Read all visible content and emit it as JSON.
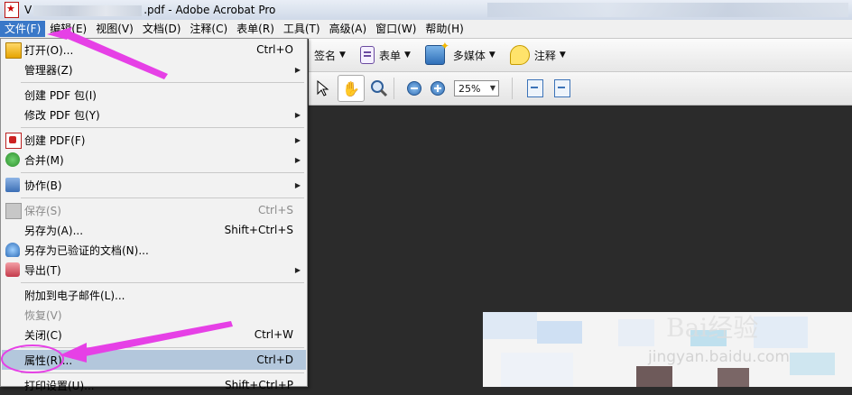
{
  "window": {
    "title_prefix": "V",
    "title_suffix": ".pdf - Adobe Acrobat Pro"
  },
  "menubar": [
    {
      "name": "menu-file",
      "label": "文件(F)",
      "active": true
    },
    {
      "name": "menu-edit",
      "label": "编辑(E)"
    },
    {
      "name": "menu-view",
      "label": "视图(V)"
    },
    {
      "name": "menu-document",
      "label": "文档(D)"
    },
    {
      "name": "menu-comments",
      "label": "注释(C)"
    },
    {
      "name": "menu-forms",
      "label": "表单(R)"
    },
    {
      "name": "menu-tools",
      "label": "工具(T)"
    },
    {
      "name": "menu-advanced",
      "label": "高级(A)"
    },
    {
      "name": "menu-window",
      "label": "窗口(W)"
    },
    {
      "name": "menu-help",
      "label": "帮助(H)"
    }
  ],
  "toolbar1": {
    "sign_label": "签名",
    "forms_label": "表单",
    "multimedia_label": "多媒体",
    "comment_label": "注释"
  },
  "toolbar2": {
    "zoom_value": "25%"
  },
  "file_menu": {
    "items": [
      {
        "label": "打开(O)...",
        "shortcut": "Ctrl+O"
      },
      {
        "label": "管理器(Z)"
      },
      {
        "label": "创建 PDF 包(I)"
      },
      {
        "label": "修改 PDF 包(Y)"
      },
      {
        "label": "创建 PDF(F)"
      },
      {
        "label": "合并(M)"
      },
      {
        "label": "协作(B)"
      },
      {
        "label": "保存(S)",
        "shortcut": "Ctrl+S"
      },
      {
        "label": "另存为(A)...",
        "shortcut": "Shift+Ctrl+S"
      },
      {
        "label": "另存为已验证的文档(N)..."
      },
      {
        "label": "导出(T)"
      },
      {
        "label": "附加到电子邮件(L)..."
      },
      {
        "label": "恢复(V)"
      },
      {
        "label": "关闭(C)",
        "shortcut": "Ctrl+W"
      },
      {
        "label": "属性(R)...",
        "shortcut": "Ctrl+D"
      },
      {
        "label": "打印设置(U)...",
        "shortcut": "Shift+Ctrl+P"
      }
    ]
  },
  "watermark": {
    "brand": "Bai经验",
    "url": "jingyan.baidu.com"
  },
  "colors": {
    "menu_active": "#3a78c8",
    "selected_item": "#b3c7dc",
    "annotation_arrow": "#e640e6",
    "doc_background": "#2b2b2b"
  }
}
